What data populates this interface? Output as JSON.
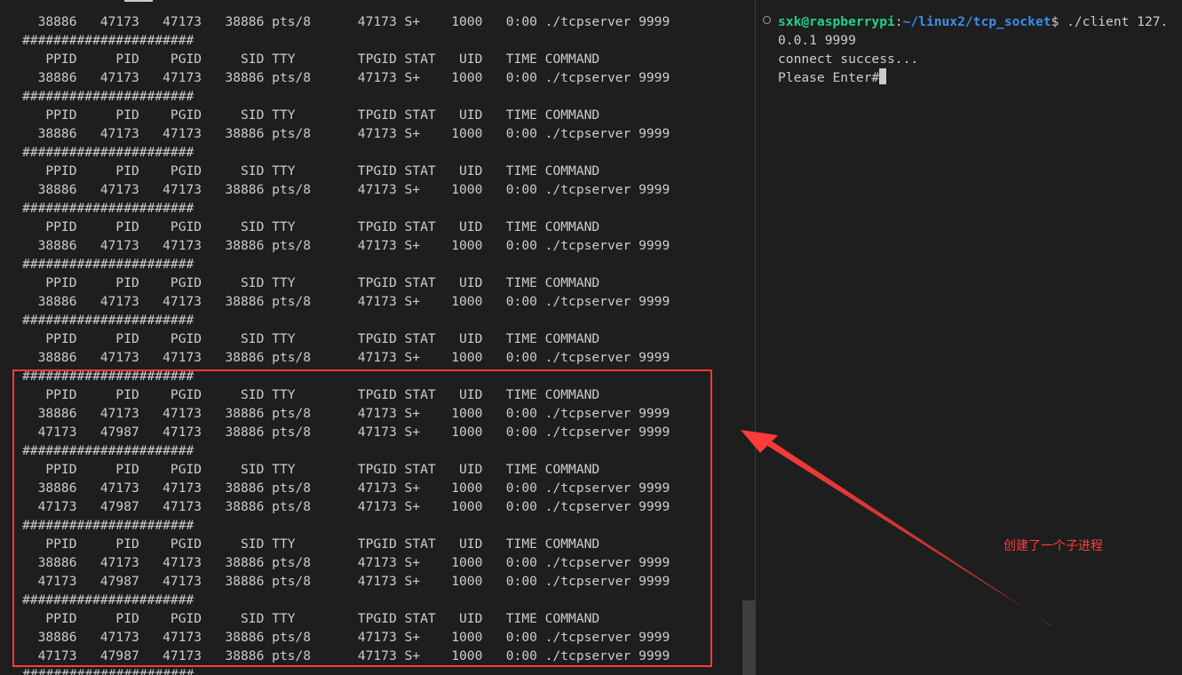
{
  "left_terminal": {
    "lines": [
      "  38886   47173   47173   38886 pts/8      47173 S+    1000   0:00 ./tcpserver 9999",
      "######################",
      "   PPID     PID    PGID     SID TTY        TPGID STAT   UID   TIME COMMAND",
      "  38886   47173   47173   38886 pts/8      47173 S+    1000   0:00 ./tcpserver 9999",
      "######################",
      "   PPID     PID    PGID     SID TTY        TPGID STAT   UID   TIME COMMAND",
      "  38886   47173   47173   38886 pts/8      47173 S+    1000   0:00 ./tcpserver 9999",
      "######################",
      "   PPID     PID    PGID     SID TTY        TPGID STAT   UID   TIME COMMAND",
      "  38886   47173   47173   38886 pts/8      47173 S+    1000   0:00 ./tcpserver 9999",
      "######################",
      "   PPID     PID    PGID     SID TTY        TPGID STAT   UID   TIME COMMAND",
      "  38886   47173   47173   38886 pts/8      47173 S+    1000   0:00 ./tcpserver 9999",
      "######################",
      "   PPID     PID    PGID     SID TTY        TPGID STAT   UID   TIME COMMAND",
      "  38886   47173   47173   38886 pts/8      47173 S+    1000   0:00 ./tcpserver 9999",
      "######################",
      "   PPID     PID    PGID     SID TTY        TPGID STAT   UID   TIME COMMAND",
      "  38886   47173   47173   38886 pts/8      47173 S+    1000   0:00 ./tcpserver 9999",
      "######################",
      "   PPID     PID    PGID     SID TTY        TPGID STAT   UID   TIME COMMAND",
      "  38886   47173   47173   38886 pts/8      47173 S+    1000   0:00 ./tcpserver 9999",
      "  47173   47987   47173   38886 pts/8      47173 S+    1000   0:00 ./tcpserver 9999",
      "######################",
      "   PPID     PID    PGID     SID TTY        TPGID STAT   UID   TIME COMMAND",
      "  38886   47173   47173   38886 pts/8      47173 S+    1000   0:00 ./tcpserver 9999",
      "  47173   47987   47173   38886 pts/8      47173 S+    1000   0:00 ./tcpserver 9999",
      "######################",
      "   PPID     PID    PGID     SID TTY        TPGID STAT   UID   TIME COMMAND",
      "  38886   47173   47173   38886 pts/8      47173 S+    1000   0:00 ./tcpserver 9999",
      "  47173   47987   47173   38886 pts/8      47173 S+    1000   0:00 ./tcpserver 9999",
      "######################",
      "   PPID     PID    PGID     SID TTY        TPGID STAT   UID   TIME COMMAND",
      "  38886   47173   47173   38886 pts/8      47173 S+    1000   0:00 ./tcpserver 9999",
      "  47173   47987   47173   38886 pts/8      47173 S+    1000   0:00 ./tcpserver 9999",
      "######################"
    ]
  },
  "right_terminal": {
    "prompt_user": "sxk@raspberrypi",
    "prompt_sep": ":",
    "prompt_path": "~/linux2/tcp_socket",
    "prompt_command": "$ ./client 127.",
    "wrapped_line": "0.0.1 9999",
    "output_line_1": "connect success...",
    "output_line_2": "Please Enter#"
  },
  "annotation": {
    "text": "创建了一个子进程",
    "color": "#ff3b3b"
  },
  "colors": {
    "background": "#1e1e1e",
    "foreground": "#cccccc",
    "prompt_user": "#23d18b",
    "prompt_path": "#3b8eea"
  }
}
